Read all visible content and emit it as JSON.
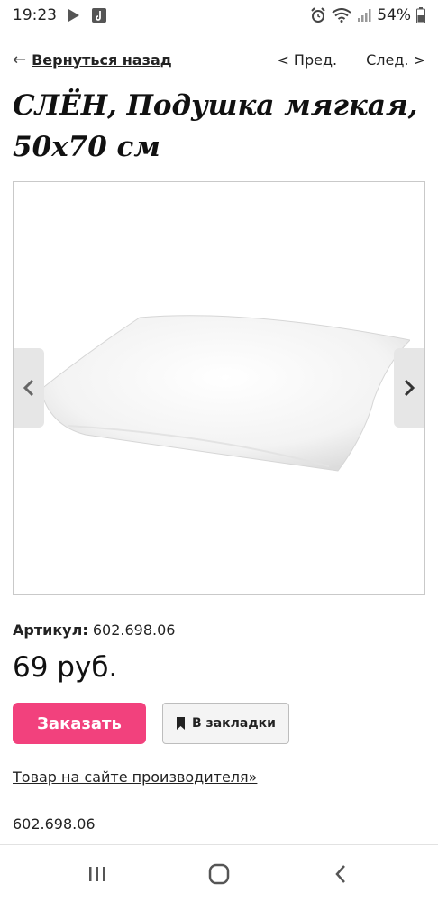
{
  "status_bar": {
    "time": "19:23",
    "battery": "54%",
    "icons": [
      "play-store-icon",
      "music-note-icon",
      "alarm-icon",
      "wifi-icon",
      "signal-icon",
      "battery-icon"
    ]
  },
  "nav": {
    "back_label": "Вернуться назад",
    "prev_label": "< Пред.",
    "next_label": "След. >"
  },
  "product": {
    "title": "СЛЁН, Подушка мягкая, 50x70 см",
    "sku_label": "Артикул:",
    "sku_value": "602.698.06",
    "price": "69 руб.",
    "order_label": "Заказать",
    "bookmark_label": "В закладки",
    "maker_link": "Товар на сайте производителя»",
    "footer_sku": "602.698.06"
  },
  "colors": {
    "accent": "#f2417d",
    "text": "#1a1a1a",
    "border": "#c9c9c9"
  },
  "system_nav": {
    "icons": [
      "recent-apps-icon",
      "home-icon",
      "back-icon"
    ]
  }
}
